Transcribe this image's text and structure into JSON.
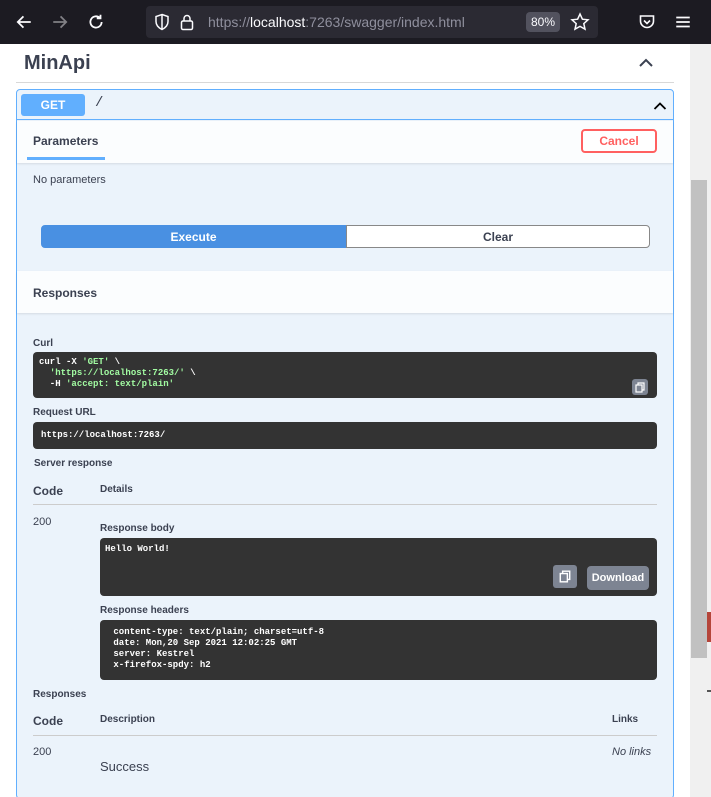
{
  "browser": {
    "url_prefix": "https://",
    "url_host": "localhost",
    "url_rest": ":7263/swagger/index.html",
    "zoom": "80%"
  },
  "section": {
    "title": "MinApi"
  },
  "operation": {
    "method": "GET",
    "path": "/",
    "parameters_tab": "Parameters",
    "cancel_label": "Cancel",
    "no_params": "No parameters",
    "execute_label": "Execute",
    "clear_label": "Clear",
    "responses_title": "Responses"
  },
  "result": {
    "curl_label": "Curl",
    "curl_line1_cmd": "curl -X ",
    "curl_line1_str": "'GET'",
    "curl_line1_end": " \\",
    "curl_line2_str": "'https://localhost:7263/'",
    "curl_line2_end": " \\",
    "curl_line3_flag": "  -H ",
    "curl_line3_str": "'accept: text/plain'",
    "request_url_label": "Request URL",
    "request_url": "https://localhost:7263/",
    "server_response_label": "Server response",
    "code_header": "Code",
    "details_header": "Details",
    "code": "200",
    "response_body_label": "Response body",
    "response_body": "Hello World!",
    "download_label": "Download",
    "response_headers_label": "Response headers",
    "headers": [
      " content-type: text/plain; charset=utf-8 ",
      " date: Mon,20 Sep 2021 12:02:25 GMT ",
      " server: Kestrel ",
      " x-firefox-spdy: h2 "
    ]
  },
  "responses_table": {
    "title": "Responses",
    "code_header": "Code",
    "description_header": "Description",
    "links_header": "Links",
    "rows": [
      {
        "code": "200",
        "description": "Success",
        "links": "No links"
      }
    ]
  }
}
